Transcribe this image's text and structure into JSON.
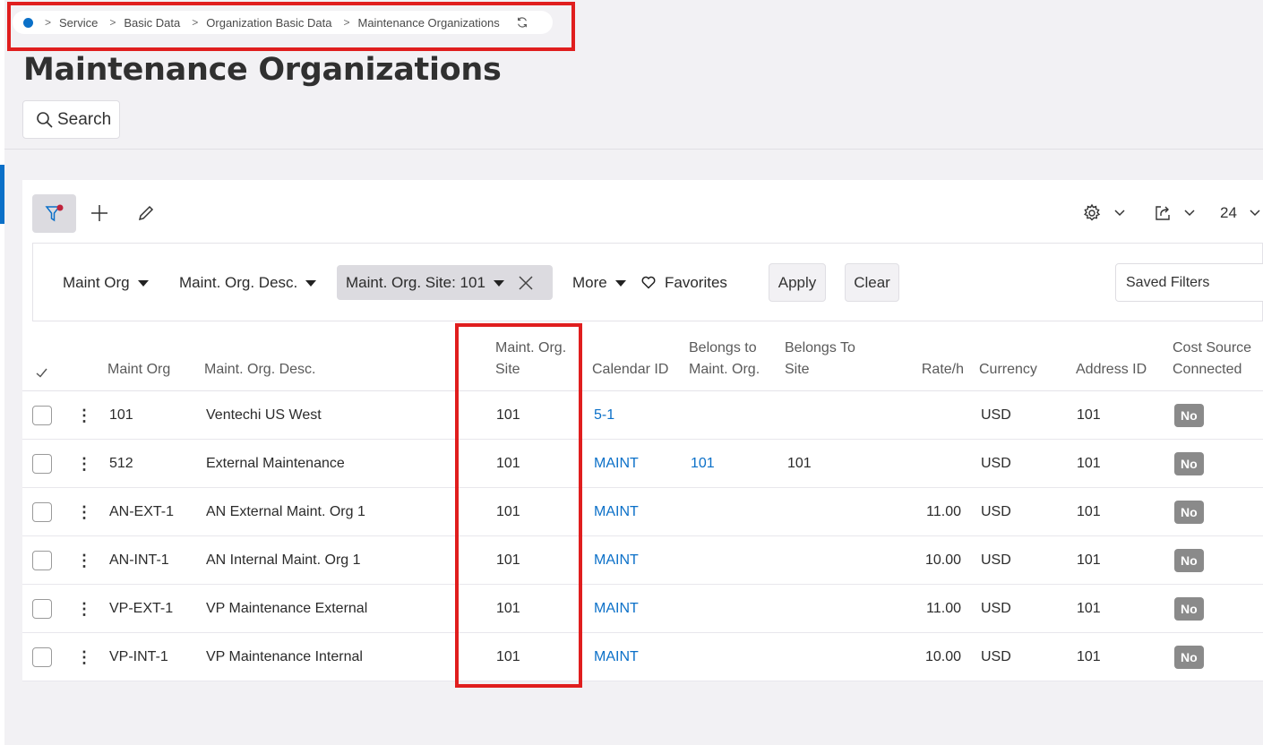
{
  "breadcrumb": [
    "Service",
    "Basic Data",
    "Organization Basic Data",
    "Maintenance Organizations"
  ],
  "page_title": "Maintenance Organizations",
  "search_label": "Search",
  "toolbar": {
    "page_size": "24"
  },
  "filters": {
    "chips": [
      "Maint Org",
      "Maint. Org. Desc.",
      "Maint. Org. Site: 101",
      "More"
    ],
    "favorites": "Favorites",
    "apply": "Apply",
    "clear": "Clear",
    "saved_filters": "Saved Filters"
  },
  "table": {
    "headers": {
      "maint_org": "Maint Org",
      "desc": "Maint. Org. Desc.",
      "site1": "Maint. Org.",
      "site2": "Site",
      "calendar": "Calendar ID",
      "belongs_org1": "Belongs to",
      "belongs_org2": "Maint. Org.",
      "belongs_site1": "Belongs To",
      "belongs_site2": "Site",
      "rate": "Rate/h",
      "currency": "Currency",
      "address": "Address ID",
      "cost1": "Cost Source",
      "cost2": "Connected"
    },
    "rows": [
      {
        "org": "101",
        "desc": "Ventechi US West",
        "site": "101",
        "calendar": "5-1",
        "belongs_org": "",
        "belongs_site": "",
        "rate": "",
        "currency": "USD",
        "address": "101",
        "cost": "No"
      },
      {
        "org": "512",
        "desc": "External Maintenance",
        "site": "101",
        "calendar": "MAINT",
        "belongs_org": "101",
        "belongs_site": "101",
        "rate": "",
        "currency": "USD",
        "address": "101",
        "cost": "No"
      },
      {
        "org": "AN-EXT-1",
        "desc": "AN External Maint. Org 1",
        "site": "101",
        "calendar": "MAINT",
        "belongs_org": "",
        "belongs_site": "",
        "rate": "11.00",
        "currency": "USD",
        "address": "101",
        "cost": "No"
      },
      {
        "org": "AN-INT-1",
        "desc": "AN Internal Maint. Org 1",
        "site": "101",
        "calendar": "MAINT",
        "belongs_org": "",
        "belongs_site": "",
        "rate": "10.00",
        "currency": "USD",
        "address": "101",
        "cost": "No"
      },
      {
        "org": "VP-EXT-1",
        "desc": "VP Maintenance External",
        "site": "101",
        "calendar": "MAINT",
        "belongs_org": "",
        "belongs_site": "",
        "rate": "11.00",
        "currency": "USD",
        "address": "101",
        "cost": "No"
      },
      {
        "org": "VP-INT-1",
        "desc": "VP Maintenance Internal",
        "site": "101",
        "calendar": "MAINT",
        "belongs_org": "",
        "belongs_site": "",
        "rate": "10.00",
        "currency": "USD",
        "address": "101",
        "cost": "No"
      }
    ]
  },
  "colors": {
    "accent": "#0b70c8",
    "highlight": "#e01e1e",
    "badge": "#8a8a8a",
    "filter_dot": "#c0223b"
  }
}
